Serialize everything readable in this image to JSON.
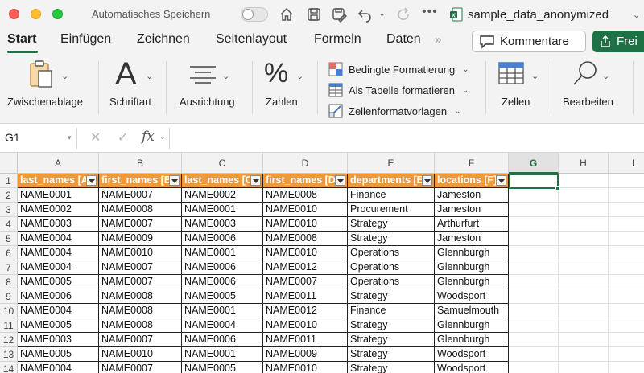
{
  "titlebar": {
    "autosave_label": "Automatisches Speichern",
    "document_name": "sample_data_anonymized",
    "icons": [
      "home-icon",
      "save-icon",
      "save-as-icon",
      "undo-icon",
      "redo-icon",
      "more-icon",
      "excel-file-icon"
    ]
  },
  "tabs": {
    "items": [
      "Start",
      "Einfügen",
      "Zeichnen",
      "Seitenlayout",
      "Formeln",
      "Daten"
    ],
    "active": "Start",
    "more": "»",
    "comment_label": "Kommentare",
    "share_label": "Frei"
  },
  "ribbon": {
    "clipboard": "Zwischenablage",
    "font": "Schriftart",
    "alignment": "Ausrichtung",
    "number": "Zahlen",
    "conditional_formatting": "Bedingte Formatierung",
    "format_as_table": "Als Tabelle formatieren",
    "cell_styles": "Zellenformatvorlagen",
    "cells": "Zellen",
    "editing": "Bearbeiten",
    "font_glyph": "A",
    "number_glyph": "%"
  },
  "formula_bar": {
    "name_box": "G1",
    "fx": "fx",
    "formula": ""
  },
  "sheet": {
    "columns": [
      "A",
      "B",
      "C",
      "D",
      "E",
      "F",
      "G",
      "H",
      "I"
    ],
    "selected_column": "G",
    "row_numbers": [
      "1",
      "2",
      "3",
      "4",
      "5",
      "6",
      "7",
      "8",
      "9",
      "10",
      "11",
      "12",
      "13",
      "14"
    ],
    "table_header": [
      "last_names [A]",
      "first_names [B]",
      "last_names [C]",
      "first_names [D]",
      "departments [E]",
      "locations [F]"
    ],
    "rows": [
      [
        "NAME0001",
        "NAME0007",
        "NAME0002",
        "NAME0008",
        "Finance",
        "Jameston"
      ],
      [
        "NAME0002",
        "NAME0008",
        "NAME0001",
        "NAME0010",
        "Procurement",
        "Jameston"
      ],
      [
        "NAME0003",
        "NAME0007",
        "NAME0003",
        "NAME0010",
        "Strategy",
        "Arthurfurt"
      ],
      [
        "NAME0004",
        "NAME0009",
        "NAME0006",
        "NAME0008",
        "Strategy",
        "Jameston"
      ],
      [
        "NAME0004",
        "NAME0010",
        "NAME0001",
        "NAME0010",
        "Operations",
        "Glennburgh"
      ],
      [
        "NAME0004",
        "NAME0007",
        "NAME0006",
        "NAME0012",
        "Operations",
        "Glennburgh"
      ],
      [
        "NAME0005",
        "NAME0007",
        "NAME0006",
        "NAME0007",
        "Operations",
        "Glennburgh"
      ],
      [
        "NAME0006",
        "NAME0008",
        "NAME0005",
        "NAME0011",
        "Strategy",
        "Woodsport"
      ],
      [
        "NAME0004",
        "NAME0008",
        "NAME0001",
        "NAME0012",
        "Finance",
        "Samuelmouth"
      ],
      [
        "NAME0005",
        "NAME0008",
        "NAME0004",
        "NAME0010",
        "Strategy",
        "Glennburgh"
      ],
      [
        "NAME0003",
        "NAME0007",
        "NAME0006",
        "NAME0011",
        "Strategy",
        "Glennburgh"
      ],
      [
        "NAME0005",
        "NAME0010",
        "NAME0001",
        "NAME0009",
        "Strategy",
        "Woodsport"
      ],
      [
        "NAME0004",
        "NAME0007",
        "NAME0005",
        "NAME0010",
        "Strategy",
        "Woodsport"
      ]
    ]
  },
  "colors": {
    "accent": "#1e7145",
    "table_header_fill": "#ee9a3b"
  }
}
